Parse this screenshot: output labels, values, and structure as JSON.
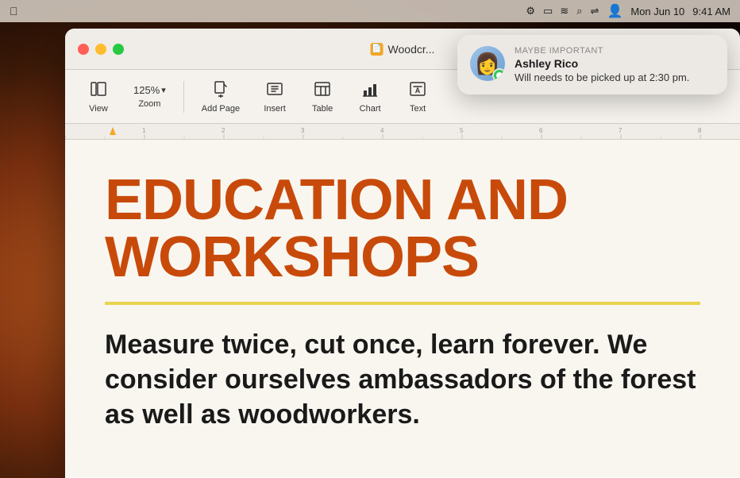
{
  "desktop": {
    "background": "macOS Ventura gradient"
  },
  "menubar": {
    "time": "9:41 AM",
    "date": "Mon Jun 10",
    "icons": [
      "settings",
      "battery",
      "wifi",
      "search",
      "user-switch",
      "account"
    ]
  },
  "window": {
    "title": "Woodcr...",
    "controls": {
      "close": "close",
      "minimize": "minimize",
      "maximize": "maximize"
    }
  },
  "toolbar": {
    "items": [
      {
        "id": "view",
        "label": "View",
        "icon": "sidebar"
      },
      {
        "id": "zoom",
        "label": "Zoom",
        "value": "125%",
        "icon": "zoom"
      },
      {
        "id": "add-page",
        "label": "Add Page",
        "icon": "add-page"
      },
      {
        "id": "insert",
        "label": "Insert",
        "icon": "insert"
      },
      {
        "id": "table",
        "label": "Table",
        "icon": "table"
      },
      {
        "id": "chart",
        "label": "Chart",
        "icon": "chart"
      },
      {
        "id": "text",
        "label": "Text",
        "icon": "text"
      }
    ],
    "zoom_value": "125%",
    "zoom_chevron": "▾"
  },
  "document": {
    "heading": "EDUCATION AND WORKSHOPS",
    "divider_color": "#e8d44d",
    "body_text": "Measure twice, cut once, learn forever. We consider ourselves ambassadors of the forest as well as woodworkers.",
    "heading_color": "#c84a0a",
    "bg_color": "#f9f6f0"
  },
  "notification": {
    "category": "MAYBE IMPORTANT",
    "sender": "Ashley Rico",
    "message": "Will needs to be picked up at 2:30 pm.",
    "app": "Messages"
  }
}
